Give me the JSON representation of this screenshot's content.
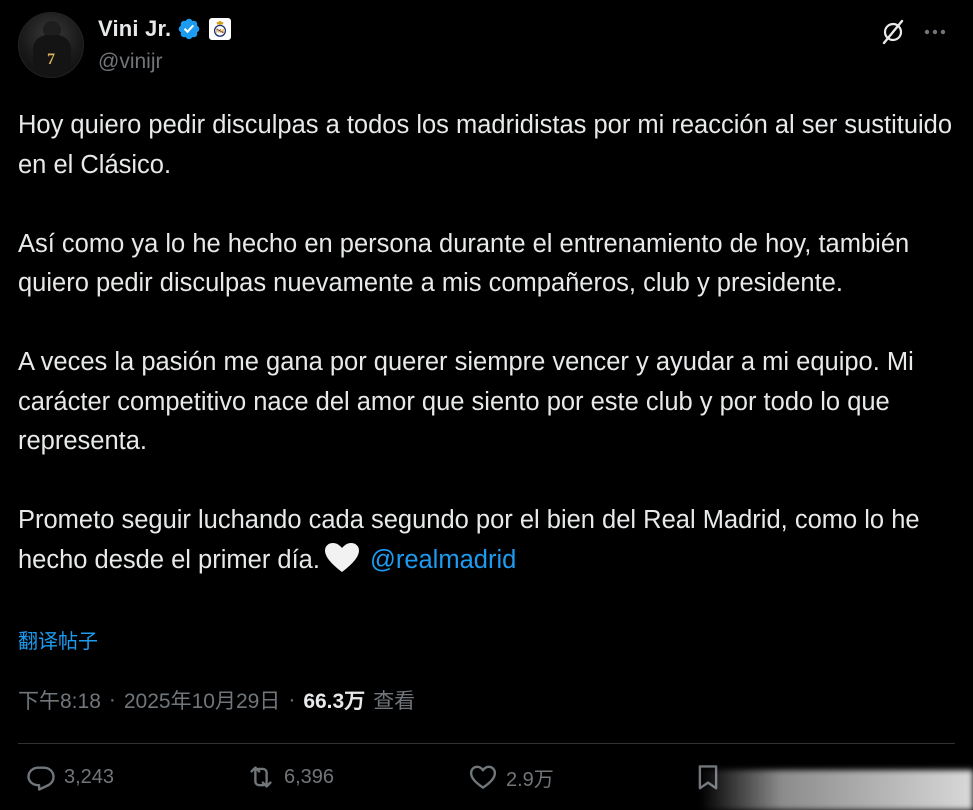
{
  "author": {
    "display_name": "Vini Jr.",
    "handle": "@vinijr",
    "verified": true,
    "affiliation_badge": "real-madrid-crest-icon",
    "jersey_number": "7"
  },
  "tweet": {
    "paragraphs": [
      "Hoy quiero pedir disculpas a todos los madridistas por mi reacción al ser sustituido en el Clásico.",
      "Así como ya lo he hecho en persona durante el entrenamiento de hoy, también quiero pedir disculpas nuevamente a mis compañeros, club y presidente.",
      "A veces la pasión me gana por querer siempre vencer y ayudar a mi equipo. Mi carácter competitivo nace del amor que siento por este club y por todo lo que representa."
    ],
    "last_paragraph": "Prometo seguir luchando cada segundo por el bien del Real Madrid, como lo he hecho desde el primer día.",
    "mention": "@realmadrid",
    "translate_label": "翻译帖子"
  },
  "meta": {
    "time": "下午8:18",
    "separator": "·",
    "date": "2025年10月29日",
    "views_count": "66.3万",
    "views_label": "查看"
  },
  "actions": {
    "reply_count": "3,243",
    "retweet_count": "6,396",
    "like_count": "2.9万"
  },
  "colors": {
    "background": "#000000",
    "text": "#e7e9ea",
    "muted": "#71767b",
    "accent": "#1d9bf0",
    "divider": "#2f3336"
  }
}
